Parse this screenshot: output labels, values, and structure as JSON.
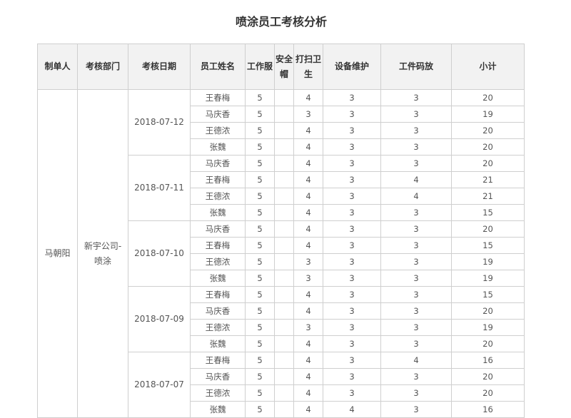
{
  "title": "喷涂员工考核分析",
  "columns": [
    "制单人",
    "考核部门",
    "考核日期",
    "员工姓名",
    "工作服",
    "安全帽",
    "打扫卫生",
    "设备维护",
    "工件码放",
    "小计"
  ],
  "preparer": "马朝阳",
  "department": "新宇公司-喷涂",
  "groups": [
    {
      "date": "2018-07-12",
      "rows": [
        {
          "name": "王春梅",
          "uniform": "5",
          "helmet": "",
          "cleaning": "4",
          "maintenance": "3",
          "stacking": "3",
          "subtotal": "20"
        },
        {
          "name": "马庆香",
          "uniform": "5",
          "helmet": "",
          "cleaning": "3",
          "maintenance": "3",
          "stacking": "3",
          "subtotal": "19"
        },
        {
          "name": "王德浓",
          "uniform": "5",
          "helmet": "",
          "cleaning": "4",
          "maintenance": "3",
          "stacking": "3",
          "subtotal": "20"
        },
        {
          "name": "张魏",
          "uniform": "5",
          "helmet": "",
          "cleaning": "4",
          "maintenance": "3",
          "stacking": "3",
          "subtotal": "20"
        }
      ]
    },
    {
      "date": "2018-07-11",
      "rows": [
        {
          "name": "马庆香",
          "uniform": "5",
          "helmet": "",
          "cleaning": "4",
          "maintenance": "3",
          "stacking": "3",
          "subtotal": "20"
        },
        {
          "name": "王春梅",
          "uniform": "5",
          "helmet": "",
          "cleaning": "4",
          "maintenance": "3",
          "stacking": "4",
          "subtotal": "21"
        },
        {
          "name": "王德浓",
          "uniform": "5",
          "helmet": "",
          "cleaning": "4",
          "maintenance": "3",
          "stacking": "4",
          "subtotal": "21"
        },
        {
          "name": "张魏",
          "uniform": "5",
          "helmet": "",
          "cleaning": "4",
          "maintenance": "3",
          "stacking": "3",
          "subtotal": "15"
        }
      ]
    },
    {
      "date": "2018-07-10",
      "rows": [
        {
          "name": "马庆香",
          "uniform": "5",
          "helmet": "",
          "cleaning": "4",
          "maintenance": "3",
          "stacking": "3",
          "subtotal": "20"
        },
        {
          "name": "王春梅",
          "uniform": "5",
          "helmet": "",
          "cleaning": "4",
          "maintenance": "3",
          "stacking": "3",
          "subtotal": "15"
        },
        {
          "name": "王德浓",
          "uniform": "5",
          "helmet": "",
          "cleaning": "3",
          "maintenance": "3",
          "stacking": "3",
          "subtotal": "19"
        },
        {
          "name": "张魏",
          "uniform": "5",
          "helmet": "",
          "cleaning": "3",
          "maintenance": "3",
          "stacking": "3",
          "subtotal": "19"
        }
      ]
    },
    {
      "date": "2018-07-09",
      "rows": [
        {
          "name": "王春梅",
          "uniform": "5",
          "helmet": "",
          "cleaning": "4",
          "maintenance": "3",
          "stacking": "3",
          "subtotal": "15"
        },
        {
          "name": "马庆香",
          "uniform": "5",
          "helmet": "",
          "cleaning": "4",
          "maintenance": "3",
          "stacking": "3",
          "subtotal": "20"
        },
        {
          "name": "王德浓",
          "uniform": "5",
          "helmet": "",
          "cleaning": "3",
          "maintenance": "3",
          "stacking": "3",
          "subtotal": "19"
        },
        {
          "name": "张魏",
          "uniform": "5",
          "helmet": "",
          "cleaning": "4",
          "maintenance": "3",
          "stacking": "3",
          "subtotal": "20"
        }
      ]
    },
    {
      "date": "2018-07-07",
      "rows": [
        {
          "name": "王春梅",
          "uniform": "5",
          "helmet": "",
          "cleaning": "4",
          "maintenance": "3",
          "stacking": "4",
          "subtotal": "16"
        },
        {
          "name": "马庆香",
          "uniform": "5",
          "helmet": "",
          "cleaning": "4",
          "maintenance": "3",
          "stacking": "3",
          "subtotal": "20"
        },
        {
          "name": "王德浓",
          "uniform": "5",
          "helmet": "",
          "cleaning": "4",
          "maintenance": "3",
          "stacking": "3",
          "subtotal": "20"
        },
        {
          "name": "张魏",
          "uniform": "5",
          "helmet": "",
          "cleaning": "4",
          "maintenance": "4",
          "stacking": "3",
          "subtotal": "16"
        }
      ]
    }
  ]
}
